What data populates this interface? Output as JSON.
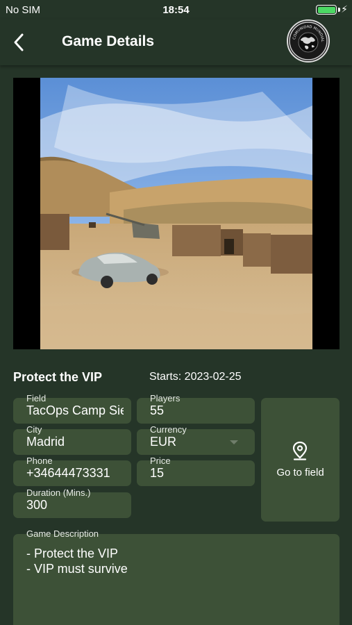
{
  "status_bar": {
    "carrier": "No SIM",
    "time": "18:54",
    "battery_level": 1.0,
    "battery_color": "#4cd964",
    "charging_icon": "bolt-icon"
  },
  "header": {
    "back_icon": "chevron-left-icon",
    "title": "Game Details",
    "logo_text": "COMUNIDAD MUNDIAL DE AIRSOFT"
  },
  "hero_image": {
    "subject": "photo of desert airsoft field with old car and wooden shacks"
  },
  "game": {
    "title": "Protect the VIP",
    "starts": "Starts: 2023-02-25"
  },
  "fields": {
    "field": {
      "label": "Field",
      "value": "TacOps Camp Sierra"
    },
    "city": {
      "label": "City",
      "value": "Madrid"
    },
    "phone": {
      "label": "Phone",
      "value": "+34644473331"
    },
    "duration": {
      "label": "Duration (Mins.)",
      "value": "300"
    },
    "players": {
      "label": "Players",
      "value": "55"
    },
    "currency": {
      "label": "Currency",
      "value": "EUR"
    },
    "price": {
      "label": "Price",
      "value": "15"
    }
  },
  "go_to_field": {
    "icon": "map-pin-icon",
    "label": "Go to field"
  },
  "description": {
    "label": "Game Description",
    "lines": [
      "- Protect the VIP",
      "- VIP must survive"
    ]
  },
  "colors": {
    "background": "#253528",
    "field_fill": "#3d5137",
    "text": "#ffffff"
  }
}
